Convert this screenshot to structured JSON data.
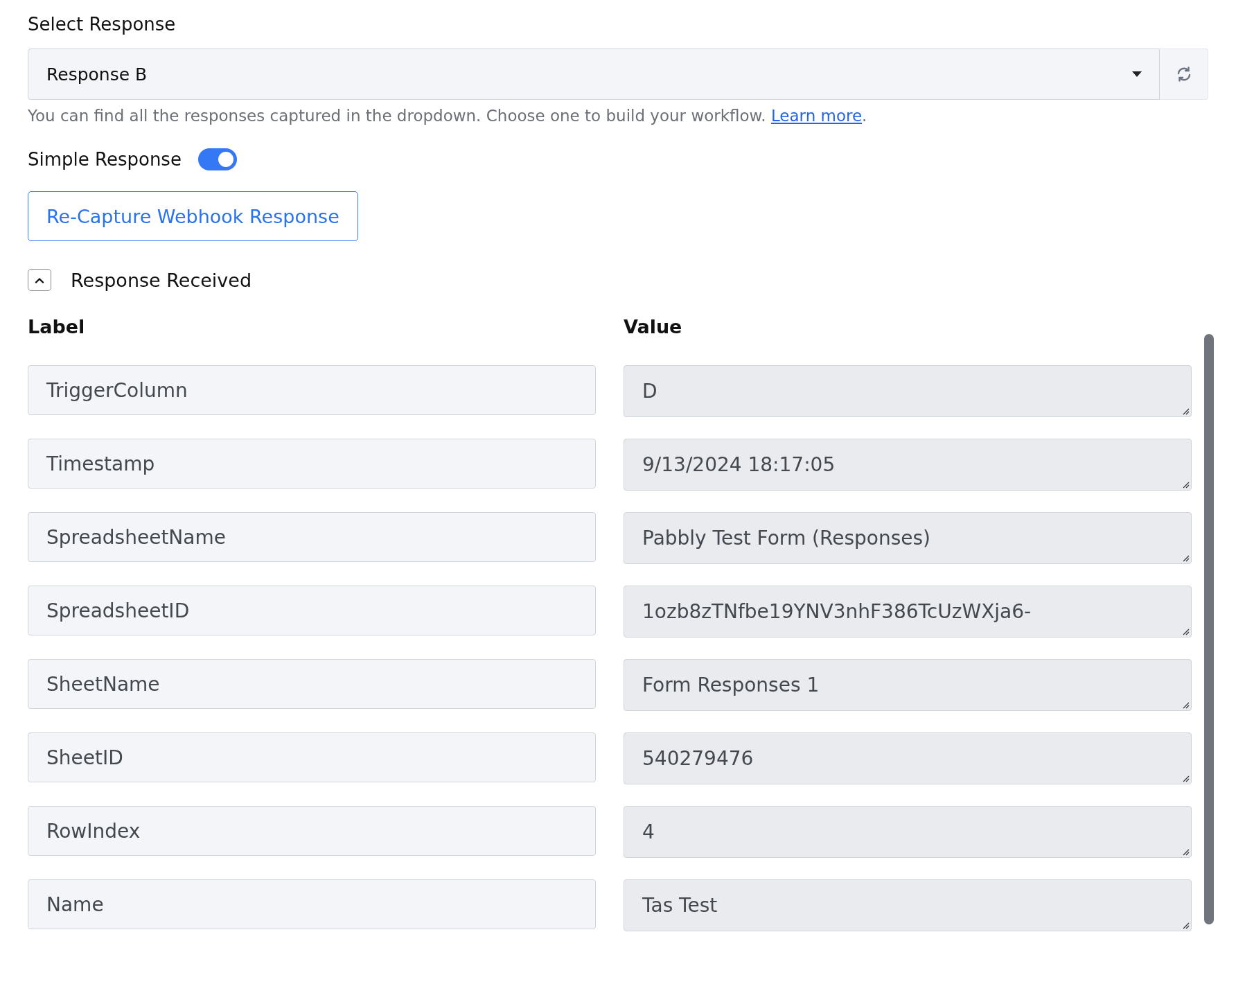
{
  "select_response": {
    "label": "Select Response",
    "value": "Response B",
    "help_text": "You can find all the responses captured in the dropdown. Choose one to build your workflow.",
    "help_link": "Learn more",
    "help_end": "."
  },
  "simple_response": {
    "label": "Simple Response",
    "on": true
  },
  "recapture_button": "Re-Capture Webhook Response",
  "response_received": {
    "label": "Response Received",
    "expanded": true
  },
  "table": {
    "columns": [
      "Label",
      "Value"
    ],
    "rows": [
      {
        "label": "TriggerColumn",
        "value": "D"
      },
      {
        "label": "Timestamp",
        "value": "9/13/2024 18:17:05"
      },
      {
        "label": "SpreadsheetName",
        "value": "Pabbly Test Form (Responses)"
      },
      {
        "label": "SpreadsheetID",
        "value": "1ozb8zTNfbe19YNV3nhF386TcUzWXja6-"
      },
      {
        "label": "SheetName",
        "value": "Form Responses 1"
      },
      {
        "label": "SheetID",
        "value": "540279476"
      },
      {
        "label": "RowIndex",
        "value": "4"
      },
      {
        "label": "Name",
        "value": "Tas Test"
      }
    ]
  }
}
